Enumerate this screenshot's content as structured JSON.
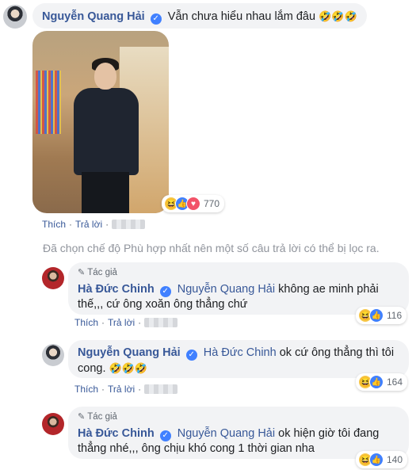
{
  "comment1": {
    "name": "Nguyễn Quang Hải",
    "text": "Vẫn chưa hiểu nhau lắm đâu",
    "emoji": "🤣🤣🤣",
    "reactions_count": "770",
    "like_label": "Thích",
    "reply_label": "Trả lời"
  },
  "notice": "Đã chọn chế độ Phù hợp nhất nên một số câu trả lời có thể bị lọc ra.",
  "replies": [
    {
      "author_tag": "Tác giả",
      "name": "Hà Đức Chinh",
      "mention": "Nguyễn Quang Hải",
      "text_line1": "không ae minh phải",
      "text_line2": "thế,,, cứ ông xoăn ông thẳng chứ",
      "reactions_count": "116"
    },
    {
      "name": "Nguyễn Quang Hải",
      "mention": "Hà Đức Chinh",
      "text_line1": "ok cứ ông thẳng thì tôi",
      "text_line2": "cong.",
      "emoji": "🤣🤣🤣",
      "reactions_count": "164"
    },
    {
      "author_tag": "Tác giả",
      "name": "Hà Đức Chinh",
      "mention": "Nguyễn Quang Hải",
      "text_line1": "ok hiện giờ tôi đang",
      "text_line2": "thẳng nhé,,, ông chịu khó cong 1 thời gian nha",
      "reactions_count": "140"
    }
  ],
  "actions": {
    "like_label": "Thích",
    "reply_label": "Trả lời"
  },
  "colors": {
    "link": "#385898",
    "bubble": "#f2f3f5",
    "muted": "#90949c"
  },
  "icons": [
    "verified-badge-icon",
    "pencil-icon",
    "haha-reaction-icon",
    "like-reaction-icon",
    "love-reaction-icon"
  ]
}
